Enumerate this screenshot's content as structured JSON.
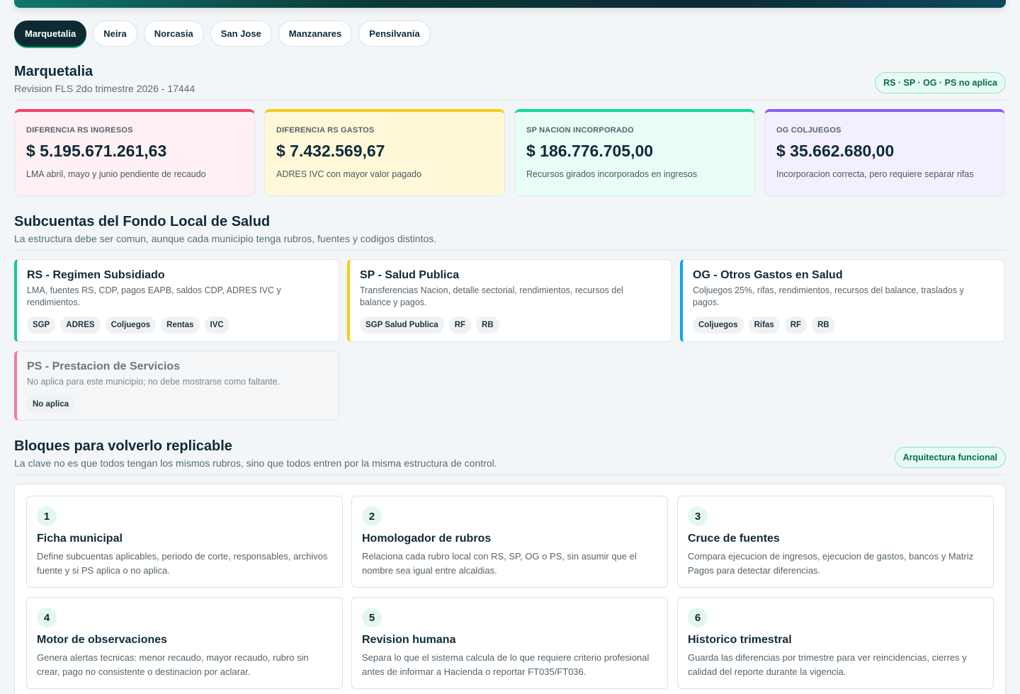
{
  "tabs": [
    "Marquetalia",
    "Neira",
    "Norcasia",
    "San Jose",
    "Manzanares",
    "Pensilvania"
  ],
  "header": {
    "title": "Marquetalia",
    "subtitle": "Revision FLS 2do trimestre 2026 - 17444",
    "scope_badge": "RS · SP · OG · PS no aplica"
  },
  "kpis": [
    {
      "label": "DIFERENCIA RS INGRESOS",
      "value": "$ 5.195.671.261,63",
      "note": "LMA abril, mayo y junio pendiente de recaudo",
      "accent": "#f43f6b",
      "bg": "#fff0f3"
    },
    {
      "label": "DIFERENCIA RS GASTOS",
      "value": "$ 7.432.569,67",
      "note": "ADRES IVC con mayor valor pagado",
      "accent": "#facc15",
      "bg": "#fff8d8"
    },
    {
      "label": "SP NACION INCORPORADO",
      "value": "$ 186.776.705,00",
      "note": "Recursos girados incorporados en ingresos",
      "accent": "#10d9a0",
      "bg": "#e8fdf6"
    },
    {
      "label": "OG COLJUEGOS",
      "value": "$ 35.662.680,00",
      "note": "Incorporacion correcta, pero requiere separar rifas",
      "accent": "#8b5cf6",
      "bg": "#f3efff"
    }
  ],
  "subcuentas": {
    "title": "Subcuentas del Fondo Local de Salud",
    "subtitle": "La estructura debe ser comun, aunque cada municipio tenga rubros, fuentes y codigos distintos.",
    "items": [
      {
        "title": "RS - Regimen Subsidiado",
        "desc": "LMA, fuentes RS, CDP, pagos EAPB, saldos CDP, ADRES IVC y rendimientos.",
        "chips": [
          "SGP",
          "ADRES",
          "Coljuegos",
          "Rentas",
          "IVC"
        ],
        "accent": "#10c98f"
      },
      {
        "title": "SP - Salud Publica",
        "desc": "Transferencias Nacion, detalle sectorial, rendimientos, recursos del balance y pagos.",
        "chips": [
          "SGP Salud Publica",
          "RF",
          "RB"
        ],
        "accent": "#facc15"
      },
      {
        "title": "OG - Otros Gastos en Salud",
        "desc": "Coljuegos 25%, rifas, rendimientos, recursos del balance, traslados y pagos.",
        "chips": [
          "Coljuegos",
          "Rifas",
          "RF",
          "RB"
        ],
        "accent": "#0ea5e9"
      },
      {
        "title": "PS - Prestacion de Servicios",
        "desc": "No aplica para este municipio; no debe mostrarse como faltante.",
        "chips": [
          "No aplica"
        ],
        "accent": "#f27c9b"
      }
    ]
  },
  "bloques": {
    "title": "Bloques para volverlo replicable",
    "subtitle": "La clave no es que todos tengan los mismos rubros, sino que todos entren por la misma estructura de control.",
    "badge": "Arquitectura funcional",
    "items": [
      {
        "num": "1",
        "title": "Ficha municipal",
        "desc": "Define subcuentas aplicables, periodo de corte, responsables, archivos fuente y si PS aplica o no aplica."
      },
      {
        "num": "2",
        "title": "Homologador de rubros",
        "desc": "Relaciona cada rubro local con RS, SP, OG o PS, sin asumir que el nombre sea igual entre alcaldias."
      },
      {
        "num": "3",
        "title": "Cruce de fuentes",
        "desc": "Compara ejecucion de ingresos, ejecucion de gastos, bancos y Matriz Pagos para detectar diferencias."
      },
      {
        "num": "4",
        "title": "Motor de observaciones",
        "desc": "Genera alertas tecnicas: menor recaudo, mayor recaudo, rubro sin crear, pago no consistente o destinacion por aclarar."
      },
      {
        "num": "5",
        "title": "Revision humana",
        "desc": "Separa lo que el sistema calcula de lo que requiere criterio profesional antes de informar a Hacienda o reportar FT035/FT036."
      },
      {
        "num": "6",
        "title": "Historico trimestral",
        "desc": "Guarda las diferencias por trimestre para ver reincidencias, cierres y calidad del reporte durante la vigencia."
      }
    ]
  }
}
